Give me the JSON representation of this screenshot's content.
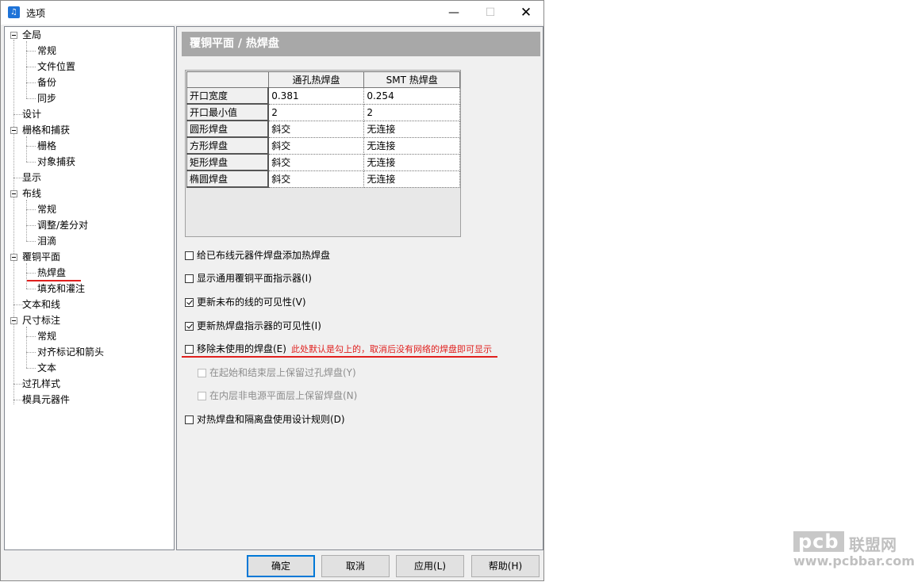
{
  "window": {
    "title": "选项",
    "app_icon": "music-note-icon",
    "controls": {
      "minimize": "—",
      "maximize": "☐",
      "close": "✕"
    }
  },
  "tree": {
    "items": [
      {
        "label": "全局",
        "level": 0,
        "expanded": true
      },
      {
        "label": "常规",
        "level": 1
      },
      {
        "label": "文件位置",
        "level": 1
      },
      {
        "label": "备份",
        "level": 1
      },
      {
        "label": "同步",
        "level": 1
      },
      {
        "label": "设计",
        "level": 0
      },
      {
        "label": "栅格和捕获",
        "level": 0,
        "expanded": true
      },
      {
        "label": "栅格",
        "level": 1
      },
      {
        "label": "对象捕获",
        "level": 1
      },
      {
        "label": "显示",
        "level": 0
      },
      {
        "label": "布线",
        "level": 0,
        "expanded": true
      },
      {
        "label": "常规",
        "level": 1
      },
      {
        "label": "调整/差分对",
        "level": 1
      },
      {
        "label": "泪滴",
        "level": 1
      },
      {
        "label": "覆铜平面",
        "level": 0,
        "expanded": true
      },
      {
        "label": "热焊盘",
        "level": 1,
        "selected": true
      },
      {
        "label": "填充和灌注",
        "level": 1
      },
      {
        "label": "文本和线",
        "level": 0
      },
      {
        "label": "尺寸标注",
        "level": 0,
        "expanded": true
      },
      {
        "label": "常规",
        "level": 1
      },
      {
        "label": "对齐标记和箭头",
        "level": 1
      },
      {
        "label": "文本",
        "level": 1
      },
      {
        "label": "过孔样式",
        "level": 0
      },
      {
        "label": "模具元器件",
        "level": 0
      }
    ]
  },
  "panel": {
    "header": "覆铜平面 / 热焊盘",
    "grid": {
      "columns": [
        "",
        "通孔热焊盘",
        "SMT 热焊盘"
      ],
      "rows": [
        [
          "开口宽度",
          "0.381",
          "0.254"
        ],
        [
          "开口最小值",
          "2",
          "2"
        ],
        [
          "圆形焊盘",
          "斜交",
          "无连接"
        ],
        [
          "方形焊盘",
          "斜交",
          "无连接"
        ],
        [
          "矩形焊盘",
          "斜交",
          "无连接"
        ],
        [
          "椭圆焊盘",
          "斜交",
          "无连接"
        ]
      ]
    },
    "options": [
      {
        "label": "给已布线元器件焊盘添加热焊盘",
        "checked": false,
        "enabled": true
      },
      {
        "label": "显示通用覆铜平面指示器(I)",
        "checked": false,
        "enabled": true
      },
      {
        "label": "更新未布的线的可见性(V)",
        "checked": true,
        "enabled": true
      },
      {
        "label": "更新热焊盘指示器的可见性(I)",
        "checked": true,
        "enabled": true
      },
      {
        "label": "移除未使用的焊盘(E)",
        "checked": false,
        "enabled": true
      },
      {
        "label": "在起始和结束层上保留过孔焊盘(Y)",
        "checked": false,
        "enabled": false
      },
      {
        "label": "在内层非电源平面层上保留焊盘(N)",
        "checked": false,
        "enabled": false
      },
      {
        "label": "对热焊盘和隔离盘使用设计规则(D)",
        "checked": false,
        "enabled": true
      }
    ],
    "annotation": "此处默认是勾上的，取消后没有网络的焊盘即可显示"
  },
  "buttons": {
    "ok": "确定",
    "cancel": "取消",
    "apply": "应用(L)",
    "help": "帮助(H)"
  },
  "watermark": {
    "logo": "pcb",
    "name": "联盟网",
    "url": "www.pcbbar.com"
  },
  "colors": {
    "annotation_red": "#e0201e",
    "header_gray": "#a8a8a8",
    "default_button_border": "#0078d7"
  }
}
